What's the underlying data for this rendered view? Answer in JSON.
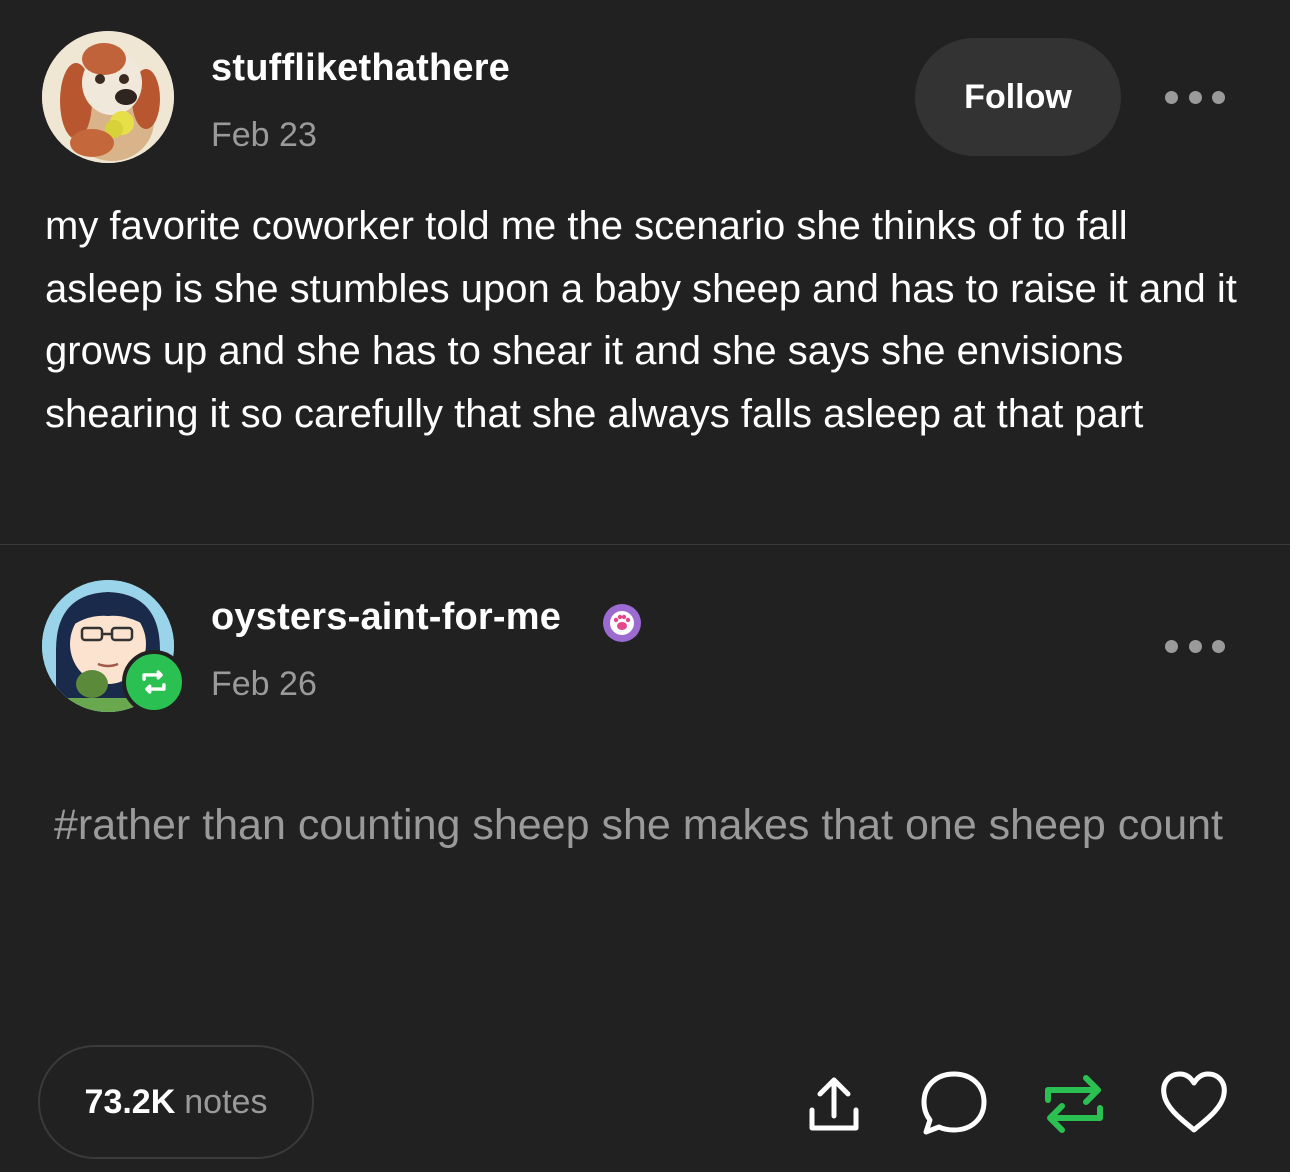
{
  "original_post": {
    "username": "stufflikethathere",
    "date": "Feb 23",
    "follow_label": "Follow",
    "body": "my favorite coworker told me the scenario she thinks of to fall asleep is she stumbles upon a baby sheep and has to raise it and it grows up and she has to shear it and she says she envisions shearing it so carefully that she always falls asleep at that part"
  },
  "reblog": {
    "username": "oysters-aint-for-me",
    "date": "Feb 26",
    "tags": "#rather than counting sheep she makes that one sheep count",
    "badge_icon": "paw-icon",
    "reblog_badge_color": "#2bc152"
  },
  "footer": {
    "notes_count": "73.2K",
    "notes_label": "notes",
    "actions": [
      "share-icon",
      "comment-icon",
      "reblog-icon",
      "like-icon"
    ],
    "reblog_color": "#2bc152"
  }
}
